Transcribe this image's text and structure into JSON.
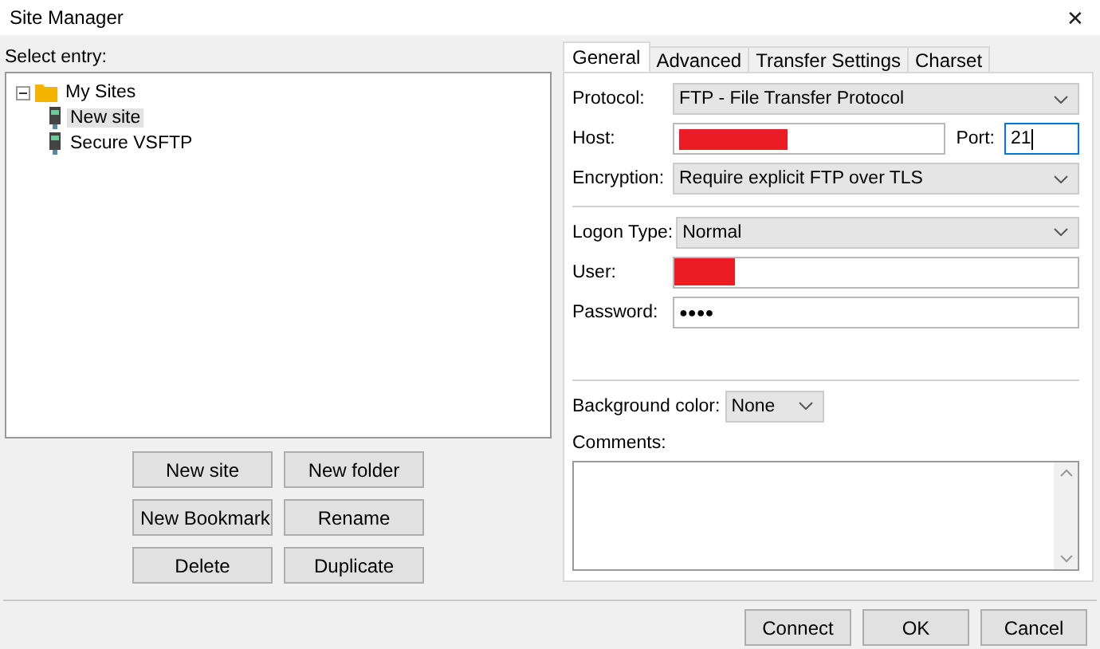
{
  "window": {
    "title": "Site Manager",
    "close": "✕"
  },
  "select_label": "Select entry:",
  "tree": [
    {
      "label": "My Sites",
      "kind": "folder",
      "expanded": true,
      "selected": false,
      "children": [
        {
          "label": "New site",
          "kind": "site",
          "selected": true
        },
        {
          "label": "Secure VSFTP",
          "kind": "site",
          "selected": false
        }
      ]
    }
  ],
  "tree_buttons": [
    "New site",
    "New folder",
    "New Bookmark",
    "Rename",
    "Delete",
    "Duplicate"
  ],
  "tabs": [
    {
      "label": "General",
      "selected": true
    },
    {
      "label": "Advanced",
      "selected": false
    },
    {
      "label": "Transfer Settings",
      "selected": false
    },
    {
      "label": "Charset",
      "selected": false
    }
  ],
  "general": {
    "protocol": {
      "label": "Protocol:",
      "value": "FTP - File Transfer Protocol"
    },
    "host": {
      "label": "Host:",
      "redacted": true
    },
    "port": {
      "label": "Port:",
      "value": "21"
    },
    "encryption": {
      "label": "Encryption:",
      "value": "Require explicit FTP over TLS"
    },
    "logon_type": {
      "label": "Logon Type:",
      "value": "Normal"
    },
    "user": {
      "label": "User:",
      "redacted": true
    },
    "password": {
      "label": "Password:",
      "value": "●●●●"
    },
    "background_color": {
      "label": "Background color:",
      "value": "None"
    },
    "comments": {
      "label": "Comments:"
    }
  },
  "footer_buttons": [
    "Connect",
    "OK",
    "Cancel"
  ]
}
